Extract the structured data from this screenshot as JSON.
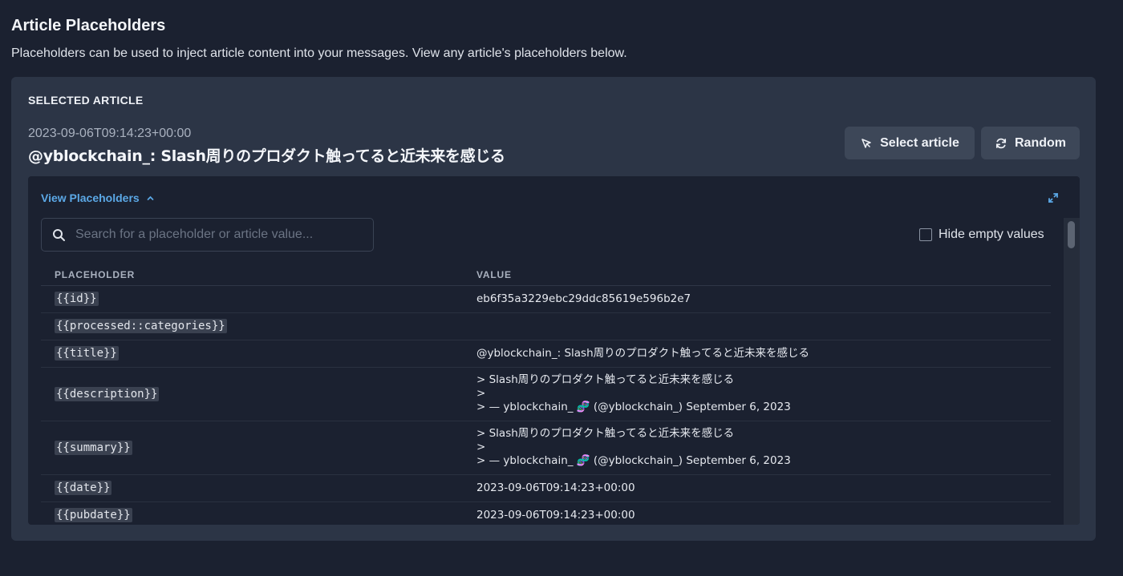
{
  "page": {
    "title": "Article Placeholders",
    "subtitle": "Placeholders can be used to inject article content into your messages. View any article's placeholders below."
  },
  "selected": {
    "label": "SELECTED ARTICLE",
    "date": "2023-09-06T09:14:23+00:00",
    "title": "@yblockchain_: Slash周りのプロダクト触ってると近未来を感じる",
    "select_button": "Select article",
    "random_button": "Random"
  },
  "placeholders": {
    "toggle_label": "View Placeholders",
    "search_placeholder": "Search for a placeholder or article value...",
    "hide_empty_label": "Hide empty values",
    "columns": {
      "placeholder": "PLACEHOLDER",
      "value": "VALUE"
    },
    "rows": [
      {
        "name": "{{id}}",
        "value": "eb6f35a3229ebc29ddc85619e596b2e7"
      },
      {
        "name": "{{processed::categories}}",
        "value": ""
      },
      {
        "name": "{{title}}",
        "value": "@yblockchain_: Slash周りのプロダクト触ってると近未来を感じる"
      },
      {
        "name": "{{description}}",
        "lines": [
          "> Slash周りのプロダクト触ってると近未来を感じる",
          ">",
          "> — yblockchain_ 🧬 (@yblockchain_) September 6, 2023"
        ]
      },
      {
        "name": "{{summary}}",
        "lines": [
          "> Slash周りのプロダクト触ってると近未来を感じる",
          ">",
          "> — yblockchain_ 🧬 (@yblockchain_) September 6, 2023"
        ]
      },
      {
        "name": "{{date}}",
        "value": "2023-09-06T09:14:23+00:00"
      },
      {
        "name": "{{pubdate}}",
        "value": "2023-09-06T09:14:23+00:00"
      }
    ]
  },
  "icons": {
    "select": "cursor-arrow-icon",
    "random": "refresh-icon",
    "toggle": "chevron-up-icon",
    "expand": "expand-icon",
    "search": "search-icon"
  },
  "colors": {
    "background": "#1b2130",
    "card": "#2c3546",
    "accent": "#5ba8e6",
    "button": "#3d4758"
  }
}
